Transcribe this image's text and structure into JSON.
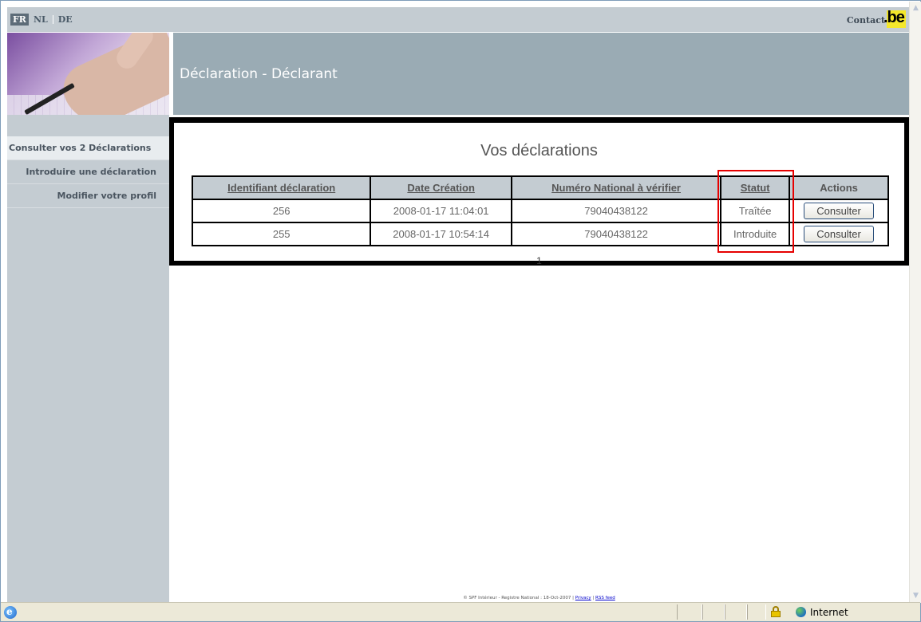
{
  "top_bar": {
    "languages": [
      {
        "label": "FR",
        "active": true
      },
      {
        "label": "NL",
        "active": false
      },
      {
        "label": "DE",
        "active": false
      }
    ],
    "contact_label": "Contact",
    "logo_text": ".be"
  },
  "banner": {
    "title": "Déclaration - Déclarant"
  },
  "sidebar": {
    "items": [
      {
        "label": "Consulter vos 2 Déclarations",
        "active": true
      },
      {
        "label": "Introduire une déclaration",
        "active": false
      },
      {
        "label": "Modifier votre profil",
        "active": false
      }
    ]
  },
  "main": {
    "title": "Vos déclarations",
    "columns": [
      "Identifiant déclaration",
      "Date Création",
      "Numéro National à vérifier",
      "Statut",
      "Actions"
    ],
    "rows": [
      {
        "id": "256",
        "date": "2008-01-17 11:04:01",
        "national_number": "79040438122",
        "status": "Traîtée",
        "action": "Consulter"
      },
      {
        "id": "255",
        "date": "2008-01-17 10:54:14",
        "national_number": "79040438122",
        "status": "Introduite",
        "action": "Consulter"
      }
    ],
    "pager": "1"
  },
  "footer": {
    "text": "© SPF Intérieur - Registre National : 18-Oct-2007 |",
    "privacy_link": "Privacy",
    "separator": "|",
    "rss_link": "RSS feed"
  },
  "status_bar": {
    "zone": "Internet"
  },
  "colors": {
    "highlight_box": "#e60000",
    "banner": "#9aabb4",
    "sidebar": "#c4ccd2"
  }
}
